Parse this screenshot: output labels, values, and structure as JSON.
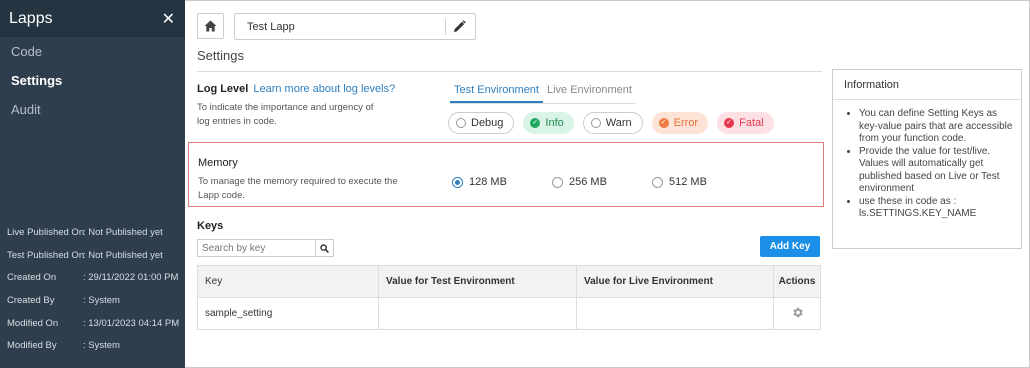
{
  "sidebar": {
    "title": "Lapps",
    "close_glyph": "✕",
    "items": [
      {
        "label": "Code"
      },
      {
        "label": "Settings"
      },
      {
        "label": "Audit"
      }
    ],
    "active_item": "Settings",
    "meta": [
      {
        "key": "Live Published On",
        "value": ": Not Published yet"
      },
      {
        "key": "Test Published On",
        "value": ": Not Published yet"
      },
      {
        "key": "Created On",
        "value": ": 29/11/2022 01:00 PM"
      },
      {
        "key": "Created By",
        "value": ": System"
      },
      {
        "key": "Modified On",
        "value": ": 13/01/2023 04:14 PM"
      },
      {
        "key": "Modified By",
        "value": ": System"
      }
    ]
  },
  "header": {
    "lapp_name": "Test Lapp",
    "home_icon": "home-icon",
    "edit_icon": "pencil-icon"
  },
  "page": {
    "title": "Settings"
  },
  "log_level": {
    "title": "Log Level",
    "link": "Learn more about log levels?",
    "description": "To indicate the importance and urgency of log entries in code.",
    "tabs": [
      {
        "label": "Test Environment"
      },
      {
        "label": "Live Environment"
      }
    ],
    "active_tab": "Test Environment",
    "levels": [
      {
        "label": "Debug",
        "selected": false
      },
      {
        "label": "Info",
        "selected": true
      },
      {
        "label": "Warn",
        "selected": false
      },
      {
        "label": "Error",
        "selected": true
      },
      {
        "label": "Fatal",
        "selected": true
      }
    ],
    "colors": {
      "info": "#1fa85f",
      "error": "#ef7b43",
      "fatal": "#e5394f"
    }
  },
  "memory": {
    "title": "Memory",
    "description": "To manage the memory required to execute the Lapp code.",
    "options": [
      {
        "label": "128 MB",
        "selected": true
      },
      {
        "label": "256 MB",
        "selected": false
      },
      {
        "label": "512 MB",
        "selected": false
      }
    ],
    "highlight_color": "#e07b7b"
  },
  "keys": {
    "title": "Keys",
    "search_placeholder": "Search by key",
    "add_label": "Add Key",
    "columns": [
      "Key",
      "Value for Test Environment",
      "Value for Live Environment",
      "Actions"
    ],
    "rows": [
      {
        "key": "sample_setting",
        "test_value": "",
        "live_value": "",
        "action_icon": "gear-icon"
      }
    ]
  },
  "information": {
    "title": "Information",
    "items": [
      "You can define Setting Keys as key-value pairs that are accessible from your function code.",
      "Provide the value for test/live. Values will automatically get published based on Live or Test environment",
      "use these in code as : ls.SETTINGS.KEY_NAME"
    ]
  },
  "accent_color": "#2d7fc1",
  "button_color": "#1b8ee8"
}
